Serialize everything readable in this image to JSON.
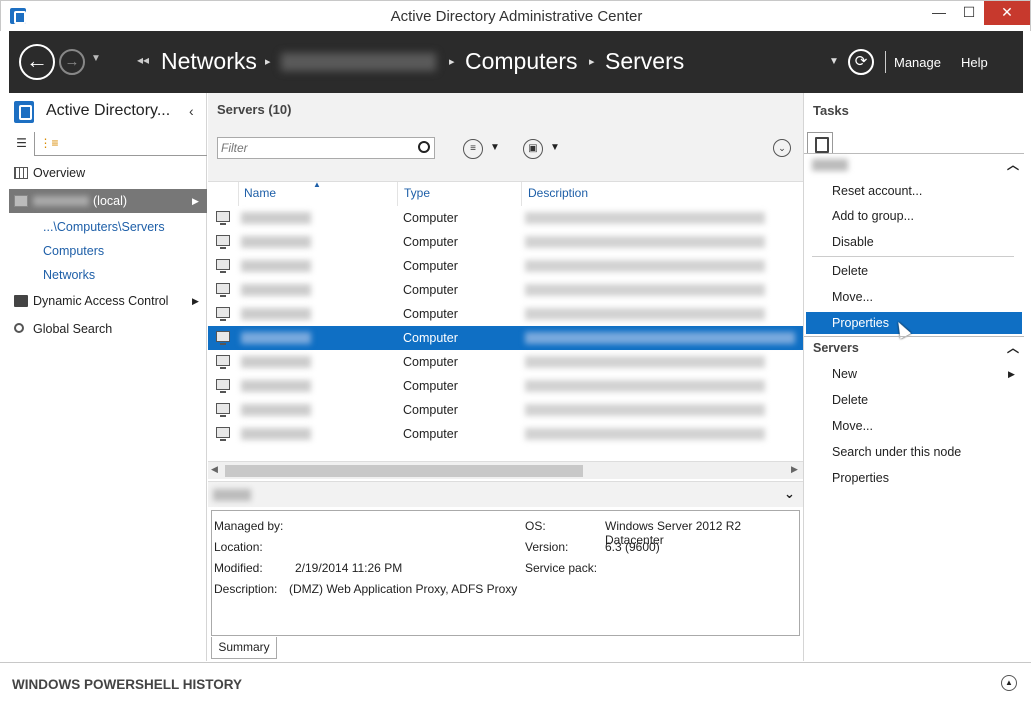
{
  "window": {
    "title": "Active Directory Administrative Center",
    "min_glyph": "—",
    "max_glyph": "☐",
    "close_glyph": "✕"
  },
  "nav": {
    "back_glyph": "←",
    "forward_glyph": "→",
    "breadcrumb": [
      "Networks",
      "Computers",
      "Servers"
    ],
    "refresh_glyph": "⟳",
    "manage_label": "Manage",
    "help_label": "Help"
  },
  "left": {
    "title": "Active Directory...",
    "collapse_glyph": "‹",
    "items": {
      "overview": "Overview",
      "local": "(local)",
      "recent_servers": "...\\Computers\\Servers",
      "recent_computers": "Computers",
      "recent_networks": "Networks",
      "dac": "Dynamic Access Control",
      "global_search": "Global Search"
    }
  },
  "center": {
    "title": "Servers  (10)",
    "filter_placeholder": "Filter",
    "columns": [
      "Name",
      "Type",
      "Description"
    ],
    "rows": [
      {
        "type": "Computer",
        "selected": false
      },
      {
        "type": "Computer",
        "selected": false
      },
      {
        "type": "Computer",
        "selected": false
      },
      {
        "type": "Computer",
        "selected": false
      },
      {
        "type": "Computer",
        "selected": false
      },
      {
        "type": "Computer",
        "selected": true
      },
      {
        "type": "Computer",
        "selected": false
      },
      {
        "type": "Computer",
        "selected": false
      },
      {
        "type": "Computer",
        "selected": false
      },
      {
        "type": "Computer",
        "selected": false
      }
    ],
    "detail": {
      "managed_by_label": "Managed by:",
      "location_label": "Location:",
      "modified_label": "Modified:",
      "modified_value": "2/19/2014 11:26 PM",
      "description_label": "Description:",
      "description_value": "(DMZ) Web Application Proxy, ADFS Proxy",
      "os_label": "OS:",
      "os_value": "Windows Server 2012 R2 Datacenter",
      "version_label": "Version:",
      "version_value": "6.3 (9600)",
      "service_pack_label": "Service pack:",
      "summary_tab": "Summary"
    }
  },
  "tasks": {
    "title": "Tasks",
    "object_items": [
      "Reset account...",
      "Add to group...",
      "Disable",
      "Delete",
      "Move...",
      "Properties"
    ],
    "servers_header": "Servers",
    "servers_items": [
      "New",
      "Delete",
      "Move...",
      "Search under this node",
      "Properties"
    ]
  },
  "powershell": {
    "title": "WINDOWS POWERSHELL HISTORY"
  },
  "colors": {
    "accent": "#0f6fc4",
    "nav_bg": "#2b2b2b",
    "link": "#1e5fa8"
  }
}
